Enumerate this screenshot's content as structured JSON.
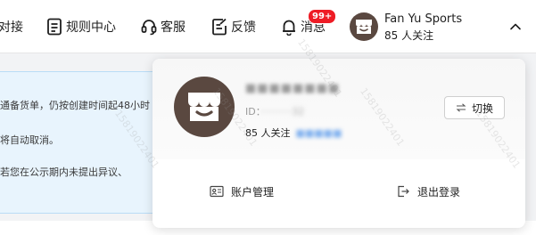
{
  "nav": {
    "items": [
      {
        "label": "对接",
        "icon": "dock-icon"
      },
      {
        "label": "规则中心",
        "icon": "rules-document-icon"
      },
      {
        "label": "客服",
        "icon": "headset-icon"
      },
      {
        "label": "反馈",
        "icon": "feedback-edit-icon"
      },
      {
        "label": "消息",
        "icon": "bell-icon"
      }
    ],
    "message_badge": "99+",
    "account": {
      "name": "Fan Yu Sports",
      "followers": "85 人关注"
    }
  },
  "notice": {
    "lines": [
      "通备货单，仍按创建时间起48小时",
      "将自动取消。",
      "若您在公示期内未提出异议、"
    ]
  },
  "panel": {
    "shop_name": "■■■■■■■■",
    "id_label": "ID：",
    "id_value": "··········32",
    "followers": "85 人关注",
    "link_text": "■■■■■",
    "switch_label": "切换",
    "account_management": "账户管理",
    "logout": "退出登录"
  },
  "watermark": "15819022401"
}
